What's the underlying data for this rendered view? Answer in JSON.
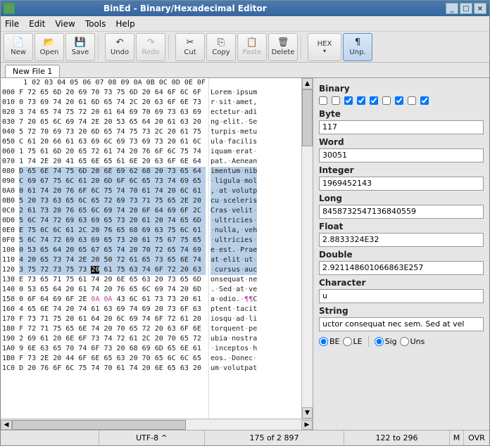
{
  "window": {
    "title": "BinEd - Binary/Hexadecimal Editor"
  },
  "menu": {
    "file": "File",
    "edit": "Edit",
    "view": "View",
    "tools": "Tools",
    "help": "Help"
  },
  "toolbar": {
    "new": "New",
    "open": "Open",
    "save": "Save",
    "undo": "Undo",
    "redo": "Redo",
    "cut": "Cut",
    "copy": "Copy",
    "paste": "Paste",
    "delete": "Delete",
    "hex": "HEX",
    "unp": "Unp."
  },
  "tab": {
    "name": "New File 1"
  },
  "hex": {
    "header": " 1 02 03 04 05 06 07 08 09 0A 0B 0C 0D 0E 0F",
    "offsets": [
      "000",
      "010",
      "020",
      "030",
      "040",
      "050",
      "060",
      "070",
      "080",
      "090",
      "0A0",
      "0B0",
      "0C0",
      "0D0",
      "0E0",
      "0F0",
      "100",
      "110",
      "120",
      "130",
      "140",
      "150",
      "160",
      "170",
      "180",
      "190",
      "1A0",
      "1B0",
      "1C0"
    ],
    "rows": [
      "F 72 65 6D 20 69 70 73 75 6D 20 64 6F 6C 6F",
      "0 73 69 74 20 61 6D 65 74 2C 20 63 6F 6E 73",
      "3 74 65 74 75 72 20 61 64 69 70 69 73 63 69",
      "7 20 65 6C 69 74 2E 20 53 65 64 20 61 63 20",
      "5 72 70 69 73 20 6D 65 74 75 73 2C 20 61 75",
      "C 61 20 66 61 63 69 6C 69 73 69 73 20 61 6C",
      "1 75 61 6D 20 65 72 61 74 20 76 6F 6C 75 74",
      "1 74 2E 20 41 65 6E 65 61 6E 20 63 6F 6E 64",
      "D 65 6E 74 75 6D 20 6E 69 62 68 20 73 65 64",
      "C 69 67 75 6C 61 20 6D 6F 6C 65 73 74 69 65",
      "0 61 74 20 76 6F 6C 75 74 70 61 74 20 6C 61",
      "5 20 73 63 65 6C 65 72 69 73 71 75 65 2E 20",
      "2 61 73 20 76 65 6C 69 74 20 6F 64 69 6F 2C",
      "5 6C 74 72 69 63 69 65 73 20 61 20 74 65 6D",
      "E 75 6C 6C 61 2C 20 76 65 68 69 63 75 6C 61",
      "5 6C 74 72 69 63 69 65 73 20 61 75 67 75 65",
      "0 53 65 64 20 65 67 65 74 20 70 72 65 74 69",
      "4 20 65 73 74 2E 20 50 72 61 65 73 65 6E 74",
      "3 75 72 73 75 73 20 61 75 63 74 6F 72 20 63",
      "E 73 65 71 75 61 74 20 6E 65 63 20 73 65 6D",
      "0 53 65 64 20 61 74 20 76 65 6C 69 74 20 6D",
      "0 6F 64 69 6F 2E 0A 0A 43 6C 61 73 73 20 61",
      "4 65 6E 74 20 74 61 63 69 74 69 20 73 6F 63",
      "F 73 71 75 20 61 64 20 6C 69 74 6F 72 61 20",
      "F 72 71 75 65 6E 74 20 70 65 72 20 63 6F 6E",
      "2 69 61 20 6E 6F 73 74 72 61 2C 20 70 65 72",
      "9 6E 63 65 70 74 6F 73 20 68 69 6D 65 6E 61",
      "F 73 2E 20 44 6F 6E 65 63 20 70 65 6C 6C 65",
      "D 20 76 6F 6C 75 74 70 61 74 20 6E 65 63 20"
    ],
    "ascii": [
      "Lorem·ipsum",
      "r·sit·amet,",
      "ectetur·adi",
      "ng·elit.·Se",
      "turpis·metu",
      "ula·facilis",
      "iquam·erat·",
      "pat.·Aenean",
      "imentum·nib",
      "·ligula·mol",
      ",·at·volutp",
      "cu·sceleris",
      "Cras·velit·",
      "·ultricies·",
      "·nulla,·veh",
      "·ultricies·",
      "e·est.·Prae",
      "at·elit·ut·",
      "·cursus·auc",
      "onsequat·ne",
      ".·Sed·at·ve",
      "a·odio.·¶¶C",
      "ptent·tacit",
      "iosqu·ad·li",
      "torquent·pe",
      "ubia·nostra",
      "·inceptos·h",
      "eos.·Donec·",
      "um·volutpat"
    ]
  },
  "inspector": {
    "binary_label": "Binary",
    "bits": [
      false,
      false,
      true,
      true,
      true,
      false,
      true,
      false,
      true
    ],
    "byte_label": "Byte",
    "byte": "117",
    "word_label": "Word",
    "word": "30051",
    "integer_label": "Integer",
    "integer": "1969452143",
    "long_label": "Long",
    "long": "8458732547136840559",
    "float_label": "Float",
    "float": "2.8833324E32",
    "double_label": "Double",
    "double": "2.921148601066863E257",
    "character_label": "Character",
    "character": "u",
    "string_label": "String",
    "string": "uctor consequat nec sem. Sed at vel",
    "be": "BE",
    "le": "LE",
    "sig": "Sig",
    "uns": "Uns"
  },
  "status": {
    "encoding": "UTF-8 ^",
    "position": "175 of 2 897",
    "selection": "122 to 296",
    "m": "M",
    "ovr": "OVR"
  }
}
